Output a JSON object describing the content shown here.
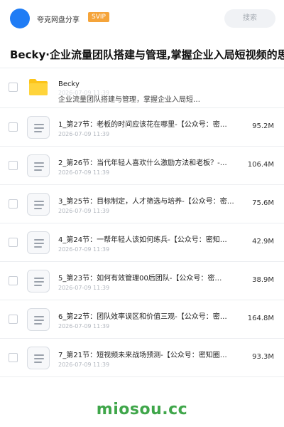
{
  "header": {
    "share_name": "夸克网盘分享",
    "svip_badge": "SVIP",
    "search_label": "搜索"
  },
  "title": "Becky·企业流量团队搭建与管理,掌握企业入局短视频的思",
  "folder": {
    "name": "Becky",
    "description": "企业流量团队搭建与管理，掌握企业入局短…",
    "date": "2026-07-09 11:39"
  },
  "files": [
    {
      "name": "1_第27节：老板的时间应该花在哪里-【公众号：密…",
      "date": "2026-07-09 11:39",
      "size": "95.2M"
    },
    {
      "name": "2_第26节：当代年轻人喜欢什么激励方法和老板？-…",
      "date": "2026-07-09 11:39",
      "size": "106.4M"
    },
    {
      "name": "3_第25节：目标制定，人才筛选与培养-【公众号：密…",
      "date": "2026-07-09 11:39",
      "size": "75.6M"
    },
    {
      "name": "4_第24节：一帮年轻人该如何练兵-【公众号：密知…",
      "date": "2026-07-09 11:39",
      "size": "42.9M"
    },
    {
      "name": "5_第23节：如何有效管理00后团队-【公众号：密…",
      "date": "2026-07-09 11:39",
      "size": "38.9M"
    },
    {
      "name": "6_第22节：团队效率误区和价值三观-【公众号：密…",
      "date": "2026-07-09 11:39",
      "size": "164.8M"
    },
    {
      "name": "7_第21节：短视频未来战场预测-【公众号：密知圈…",
      "date": "2026-07-09 11:39",
      "size": "93.3M"
    }
  ],
  "watermark": "miosou.cc",
  "colors": {
    "avatar": "#1f7cf5",
    "svip": "#f5a43a",
    "folder": "#fcc419",
    "watermark": "#3fa64a"
  }
}
